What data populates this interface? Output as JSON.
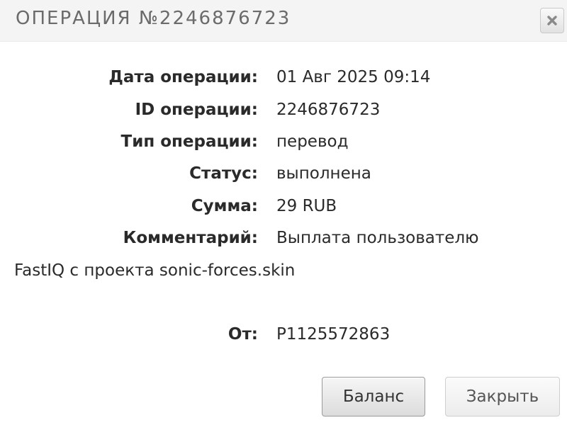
{
  "dialog": {
    "title": "ОПЕРАЦИЯ №2246876723",
    "close_icon": "close-x-icon"
  },
  "details": {
    "date_label": "Дата операции:",
    "date_value": "01 Авг 2025 09:14",
    "id_label": "ID операции:",
    "id_value": "2246876723",
    "type_label": "Тип операции:",
    "type_value": "перевод",
    "status_label": "Статус:",
    "status_value": "выполнена",
    "amount_label": "Сумма:",
    "amount_value": "29 RUB",
    "comment_label": "Комментарий:",
    "comment_value_line1": "Выплата пользователю",
    "comment_value_line2": "FastIQ с проекта sonic-forces.skin",
    "from_label": "От:",
    "from_value": "P1125572863"
  },
  "buttons": {
    "balance_label": "Баланс",
    "close_label": "Закрыть"
  }
}
